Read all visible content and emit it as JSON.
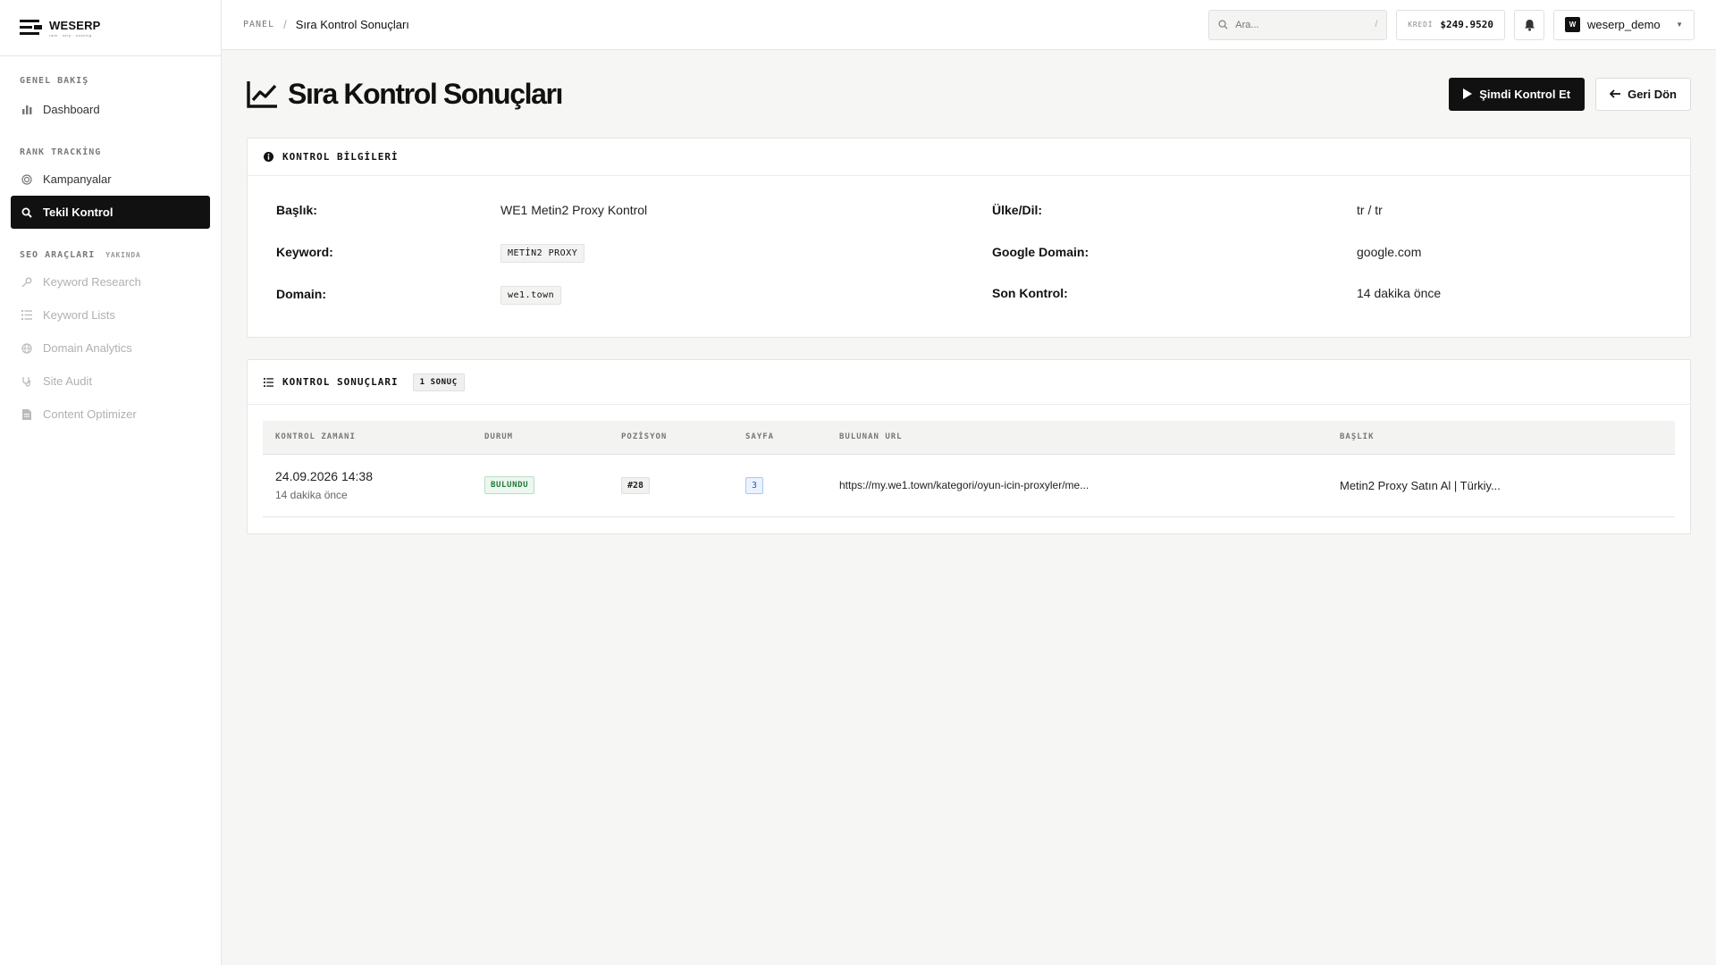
{
  "brand": {
    "name": "WESERP",
    "tagline": "rank · serp · tracking"
  },
  "sidebar": {
    "sections": [
      {
        "title": "GENEL BAKIŞ"
      },
      {
        "title": "RANK TRACKİNG"
      },
      {
        "title": "SEO ARAÇLARI",
        "badge": "YAKINDA"
      }
    ],
    "items": [
      {
        "label": "Dashboard",
        "icon": "bar-chart-icon"
      },
      {
        "label": "Kampanyalar",
        "icon": "target-icon"
      },
      {
        "label": "Tekil Kontrol",
        "icon": "search-icon",
        "active": true
      },
      {
        "label": "Keyword Research",
        "icon": "key-icon",
        "disabled": true
      },
      {
        "label": "Keyword Lists",
        "icon": "list-icon",
        "disabled": true
      },
      {
        "label": "Domain Analytics",
        "icon": "globe-icon",
        "disabled": true
      },
      {
        "label": "Site Audit",
        "icon": "stethoscope-icon",
        "disabled": true
      },
      {
        "label": "Content Optimizer",
        "icon": "document-icon",
        "disabled": true
      }
    ]
  },
  "topbar": {
    "breadcrumb_root": "PANEL",
    "breadcrumb_sep": "/",
    "breadcrumb_current": "Sıra Kontrol Sonuçları",
    "search_placeholder": "Ara...",
    "search_shortcut": "/",
    "credit_label": "KREDİ",
    "credit_value": "$249.9520",
    "user_initial": "W",
    "user_name": "weserp_demo"
  },
  "page": {
    "title": "Sıra Kontrol Sonuçları",
    "primary_action": "Şimdi Kontrol Et",
    "secondary_action": "Geri Dön"
  },
  "info_card": {
    "title": "KONTROL BİLGİLERİ",
    "fields": {
      "baslik": {
        "label": "Başlık:",
        "value": "WE1 Metin2 Proxy Kontrol"
      },
      "keyword": {
        "label": "Keyword:",
        "value": "METİN2 PROXY"
      },
      "domain": {
        "label": "Domain:",
        "value": "we1.town"
      },
      "ulke": {
        "label": "Ülke/Dil:",
        "value": "tr / tr"
      },
      "google_domain": {
        "label": "Google Domain:",
        "value": "google.com"
      },
      "son_kontrol": {
        "label": "Son Kontrol:",
        "value": "14 dakika önce"
      }
    }
  },
  "results_card": {
    "title": "KONTROL SONUÇLARI",
    "count_badge": "1 SONUÇ",
    "columns": [
      "KONTROL ZAMANI",
      "DURUM",
      "POZİSYON",
      "SAYFA",
      "BULUNAN URL",
      "BAŞLIK"
    ],
    "rows": [
      {
        "time": "24.09.2026 14:38",
        "time_ago": "14 dakika önce",
        "status": "BULUNDU",
        "position": "#28",
        "page": "3",
        "url": "https://my.we1.town/kategori/oyun-icin-proxyler/me...",
        "title": "Metin2 Proxy Satın Al | Türkiy..."
      }
    ]
  },
  "colors": {
    "accent": "#111111",
    "status_found": "#1f7a3a",
    "page_badge": "#1d5fbf",
    "background": "#f6f6f5"
  }
}
